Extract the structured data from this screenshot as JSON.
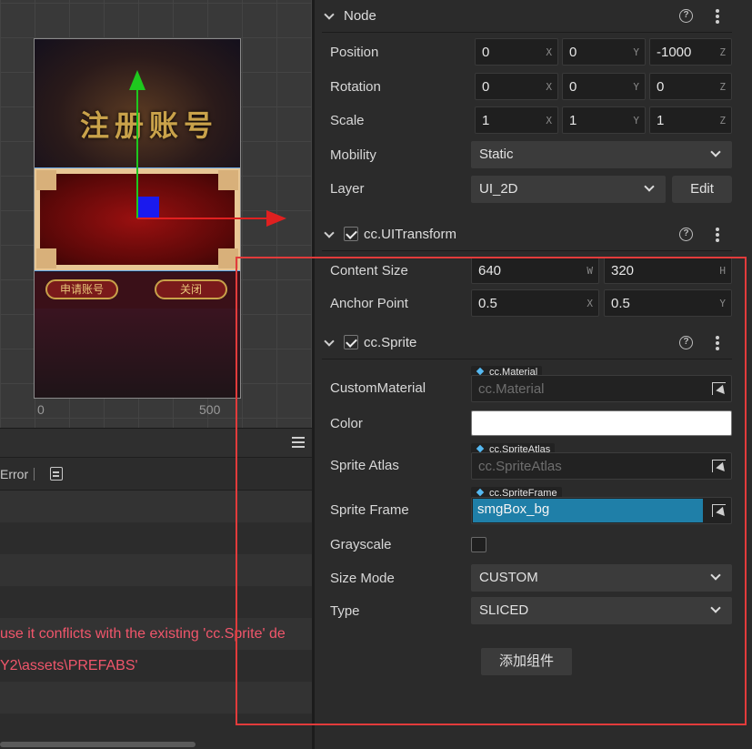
{
  "scene": {
    "title_art": "注册账号",
    "btn_left": "申请账号",
    "btn_right": "关闭",
    "ruler": {
      "label_0": "0",
      "label_500": "500"
    }
  },
  "console": {
    "error_filter": "Error",
    "rows": [
      "",
      "",
      "",
      "",
      "use it conflicts with the existing 'cc.Sprite' de",
      "Y2\\assets\\PREFABS'",
      "",
      ""
    ]
  },
  "node": {
    "title": "Node",
    "position": {
      "label": "Position",
      "x": "0",
      "y": "0",
      "z": "-1000"
    },
    "rotation": {
      "label": "Rotation",
      "x": "0",
      "y": "0",
      "z": "0"
    },
    "scale": {
      "label": "Scale",
      "x": "1",
      "y": "1",
      "z": "1"
    },
    "mobility": {
      "label": "Mobility",
      "value": "Static"
    },
    "layer": {
      "label": "Layer",
      "value": "UI_2D",
      "edit": "Edit"
    },
    "axis": {
      "x": "X",
      "y": "Y",
      "z": "Z",
      "w": "W",
      "h": "H"
    }
  },
  "ui_transform": {
    "title": "cc.UITransform",
    "enabled": true,
    "content_size": {
      "label": "Content Size",
      "w": "640",
      "h": "320"
    },
    "anchor_point": {
      "label": "Anchor Point",
      "x": "0.5",
      "y": "0.5"
    }
  },
  "sprite": {
    "title": "cc.Sprite",
    "enabled": true,
    "custom_material": {
      "label": "CustomMaterial",
      "type": "cc.Material",
      "value": "cc.Material"
    },
    "color": {
      "label": "Color",
      "value": "#ffffff"
    },
    "sprite_atlas": {
      "label": "Sprite Atlas",
      "type": "cc.SpriteAtlas",
      "value": "cc.SpriteAtlas"
    },
    "sprite_frame": {
      "label": "Sprite Frame",
      "type": "cc.SpriteFrame",
      "value": "smgBox_bg"
    },
    "grayscale": {
      "label": "Grayscale",
      "checked": false
    },
    "size_mode": {
      "label": "Size Mode",
      "value": "CUSTOM"
    },
    "type": {
      "label": "Type",
      "value": "SLICED"
    }
  },
  "add_component": "添加组件",
  "colors": {
    "highlight": "#e23b3b",
    "error_text": "#f0566b",
    "selection": "#1f7fa8",
    "axis_x": "#e02020",
    "axis_y": "#1ec81e"
  }
}
